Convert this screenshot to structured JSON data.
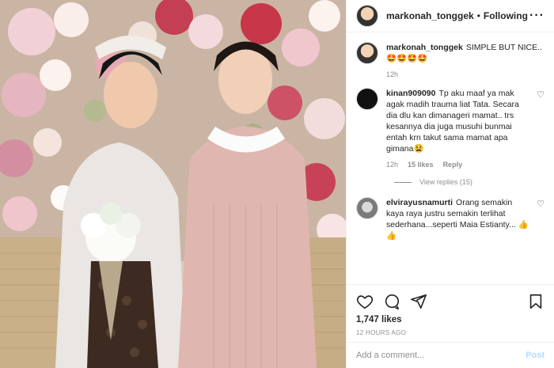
{
  "post": {
    "username": "markonah_tonggek",
    "follow_status": "Following",
    "caption_user": "markonah_tonggek",
    "caption_text": "SIMPLE BUT NICE.. 🤩🤩🤩🤩",
    "caption_time": "12h"
  },
  "comments": [
    {
      "user": "kinan909090",
      "text": "Tp aku maaf ya mak agak madih trauma liat Tata. Secara dia dlu kan dimanageri mamat.. trs kesannya dia juga musuhi bunmai entah krn takut sama mamat apa gimana😫",
      "time": "12h",
      "likes": "15 likes",
      "reply": "Reply",
      "view_replies": "View replies (15)"
    },
    {
      "user": "elvirayusnamurti",
      "text": "Orang semakin kaya raya justru semakin terlihat sederhana...seperti Maia Estianty... 👍👍"
    }
  ],
  "actions": {
    "likes": "1,747 likes",
    "timestamp": "12 HOURS AGO"
  },
  "add_comment": {
    "placeholder": "Add a comment...",
    "post_label": "Post",
    "post_color": "#b3dbff"
  },
  "icons": {
    "like": "heart-icon",
    "comment": "comment-icon",
    "share": "share-icon",
    "save": "bookmark-icon",
    "more": "more-icon"
  }
}
